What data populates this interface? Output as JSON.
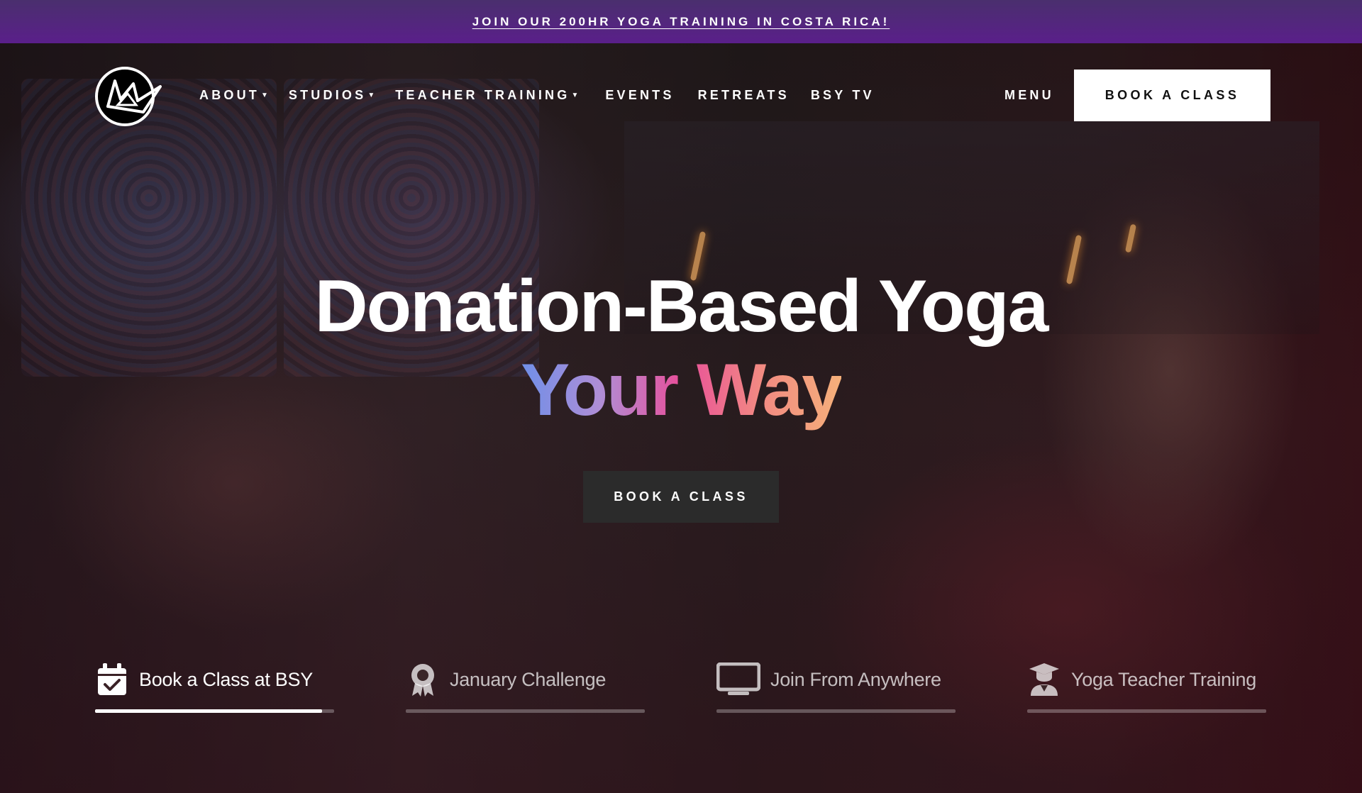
{
  "promo": {
    "text": "JOIN OUR 200HR YOGA TRAINING IN COSTA RICA!"
  },
  "header": {
    "logo_icon": "bsy-logo",
    "nav": [
      {
        "label": "ABOUT",
        "dropdown": true
      },
      {
        "label": "STUDIOS",
        "dropdown": true
      },
      {
        "label": "TEACHER TRAINING",
        "dropdown": true
      },
      {
        "label": "EVENTS",
        "dropdown": false
      },
      {
        "label": "RETREATS",
        "dropdown": false
      },
      {
        "label": "BSY TV",
        "dropdown": false
      }
    ],
    "menu_label": "MENU",
    "book_label": "BOOK A CLASS"
  },
  "hero": {
    "headline": "Donation-Based Yoga",
    "subline": "Your Way",
    "book_label": "BOOK A CLASS",
    "gradient_colors": [
      "#6f8fe8",
      "#b08ed6",
      "#e84f9a",
      "#f28a82",
      "#f5b07a"
    ]
  },
  "tabs": [
    {
      "label": "Book a Class at BSY",
      "icon": "calendar-check-icon",
      "active": true,
      "progress": 0.95
    },
    {
      "label": "January Challenge",
      "icon": "award-icon",
      "active": false,
      "progress": 0
    },
    {
      "label": "Join From Anywhere",
      "icon": "monitor-icon",
      "active": false,
      "progress": 0
    },
    {
      "label": "Yoga Teacher Training",
      "icon": "graduate-icon",
      "active": false,
      "progress": 0
    }
  ],
  "colors": {
    "promo_bg": "#5a1f8a",
    "book_top_bg": "#ffffff",
    "book_hero_bg": "#2b2b2b"
  }
}
